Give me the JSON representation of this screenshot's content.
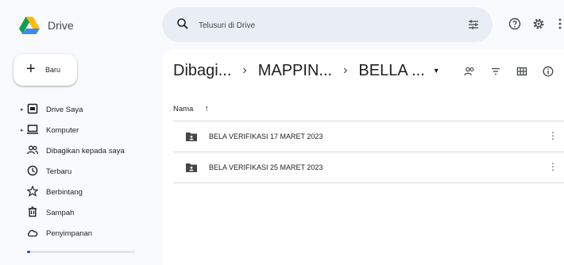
{
  "app": {
    "name": "Drive"
  },
  "search": {
    "placeholder": "Telusuri di Drive"
  },
  "header_icons": [
    "filter-icon",
    "help-icon",
    "settings-icon",
    "apps-icon"
  ],
  "sidebar": {
    "new_label": "Baru",
    "items": [
      {
        "label": "Drive Saya",
        "icon": "my-drive-icon",
        "expandable": true
      },
      {
        "label": "Komputer",
        "icon": "computer-icon",
        "expandable": true
      },
      {
        "label": "Dibagikan kepada saya",
        "icon": "shared-icon",
        "expandable": false
      },
      {
        "label": "Terbaru",
        "icon": "clock-icon",
        "expandable": false
      },
      {
        "label": "Berbintang",
        "icon": "star-icon",
        "expandable": false
      },
      {
        "label": "Sampah",
        "icon": "trash-icon",
        "expandable": false
      },
      {
        "label": "Penyimpanan",
        "icon": "cloud-icon",
        "expandable": false
      }
    ],
    "storage_used_fraction": 0.03
  },
  "breadcrumb": {
    "items": [
      "Dibagi...",
      "MAPPIN...",
      "BELLA ..."
    ]
  },
  "toolbar_icons": [
    "share-people-icon",
    "sort-filter-icon",
    "grid-view-icon",
    "info-icon"
  ],
  "list": {
    "column_name": "Nama",
    "sort_direction": "ascending",
    "rows": [
      {
        "name": "BELA VERIFIKASI 17 MARET 2023"
      },
      {
        "name": "BELA VERIFIKASI 25 MARET 2023"
      }
    ]
  },
  "colors": {
    "accent": "#0b57d0",
    "background": "#f8fafd",
    "search_bg": "#e9eef6"
  }
}
